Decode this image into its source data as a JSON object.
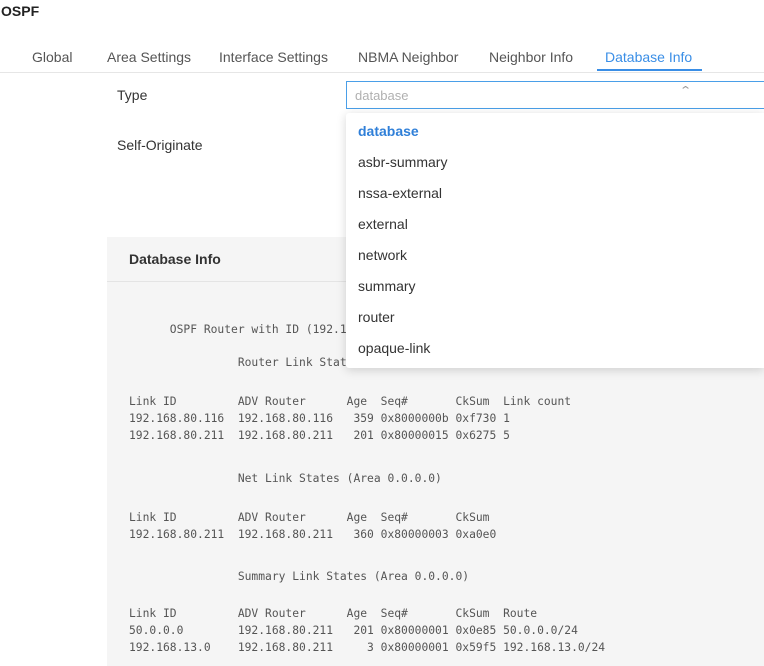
{
  "app": {
    "title": "OSPF"
  },
  "tabs": [
    {
      "label": "Global"
    },
    {
      "label": "Area Settings"
    },
    {
      "label": "Interface Settings"
    },
    {
      "label": "NBMA Neighbor"
    },
    {
      "label": "Neighbor Info"
    },
    {
      "label": "Database Info",
      "active": true
    }
  ],
  "form": {
    "type_label": "Type",
    "self_originate_label": "Self-Originate",
    "type_select": {
      "value": "database"
    }
  },
  "dropdown": {
    "options": [
      "database",
      "asbr-summary",
      "nssa-external",
      "external",
      "network",
      "summary",
      "router",
      "opaque-link"
    ],
    "selected": "database"
  },
  "panel": {
    "title": "Database Info",
    "lines": [
      "      OSPF Router with ID (192.168.80.211)",
      "                Router Link States (Area 0.0.0.0)",
      "Link ID         ADV Router      Age  Seq#       CkSum  Link count",
      "192.168.80.116  192.168.80.116   359 0x8000000b 0xf730 1",
      "192.168.80.211  192.168.80.211   201 0x80000015 0x6275 5",
      "                Net Link States (Area 0.0.0.0)",
      "Link ID         ADV Router      Age  Seq#       CkSum",
      "192.168.80.211  192.168.80.211   360 0x80000003 0xa0e0",
      "                Summary Link States (Area 0.0.0.0)",
      "Link ID         ADV Router      Age  Seq#       CkSum  Route",
      "50.0.0.0        192.168.80.211   201 0x80000001 0x0e85 50.0.0.0/24",
      "192.168.13.0    192.168.80.211     3 0x80000001 0x59f5 192.168.13.0/24"
    ]
  },
  "colors": {
    "accent": "#3a8ee6",
    "panel_bg": "#f5f5f5"
  },
  "icons": {
    "select_chevron": "chevron-up-icon"
  }
}
